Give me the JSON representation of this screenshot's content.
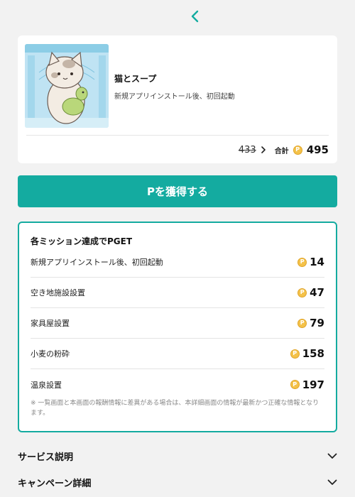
{
  "app": {
    "title": "猫とスープ",
    "subtitle": "新規アプリインストール後、初回起動",
    "old_points": "433",
    "total_label": "合計",
    "total_points": "495"
  },
  "coin_symbol": "P",
  "cta": {
    "label": "Pを獲得する"
  },
  "missions": {
    "heading": "各ミッション達成でPGET",
    "items": [
      {
        "name": "新規アプリインストール後、初回起動",
        "points": "14"
      },
      {
        "name": "空き地施設設置",
        "points": "47"
      },
      {
        "name": "家具屋設置",
        "points": "79"
      },
      {
        "name": "小麦の粉砕",
        "points": "158"
      },
      {
        "name": "温泉設置",
        "points": "197"
      }
    ],
    "disclaimer": "※ 一覧画面と本画面の報酬情報に差異がある場合は、本詳細画面の情報が最新かつ正確な情報となります。"
  },
  "accordions": {
    "service": "サービス説明",
    "campaign": "キャンペーン詳細"
  },
  "colors": {
    "accent": "#14aba0",
    "coin": "#f4c24a",
    "background": "#f2f2f2"
  },
  "icons": [
    "back-chevron-icon",
    "arrow-right-icon",
    "coin-icon",
    "chevron-down-icon"
  ]
}
